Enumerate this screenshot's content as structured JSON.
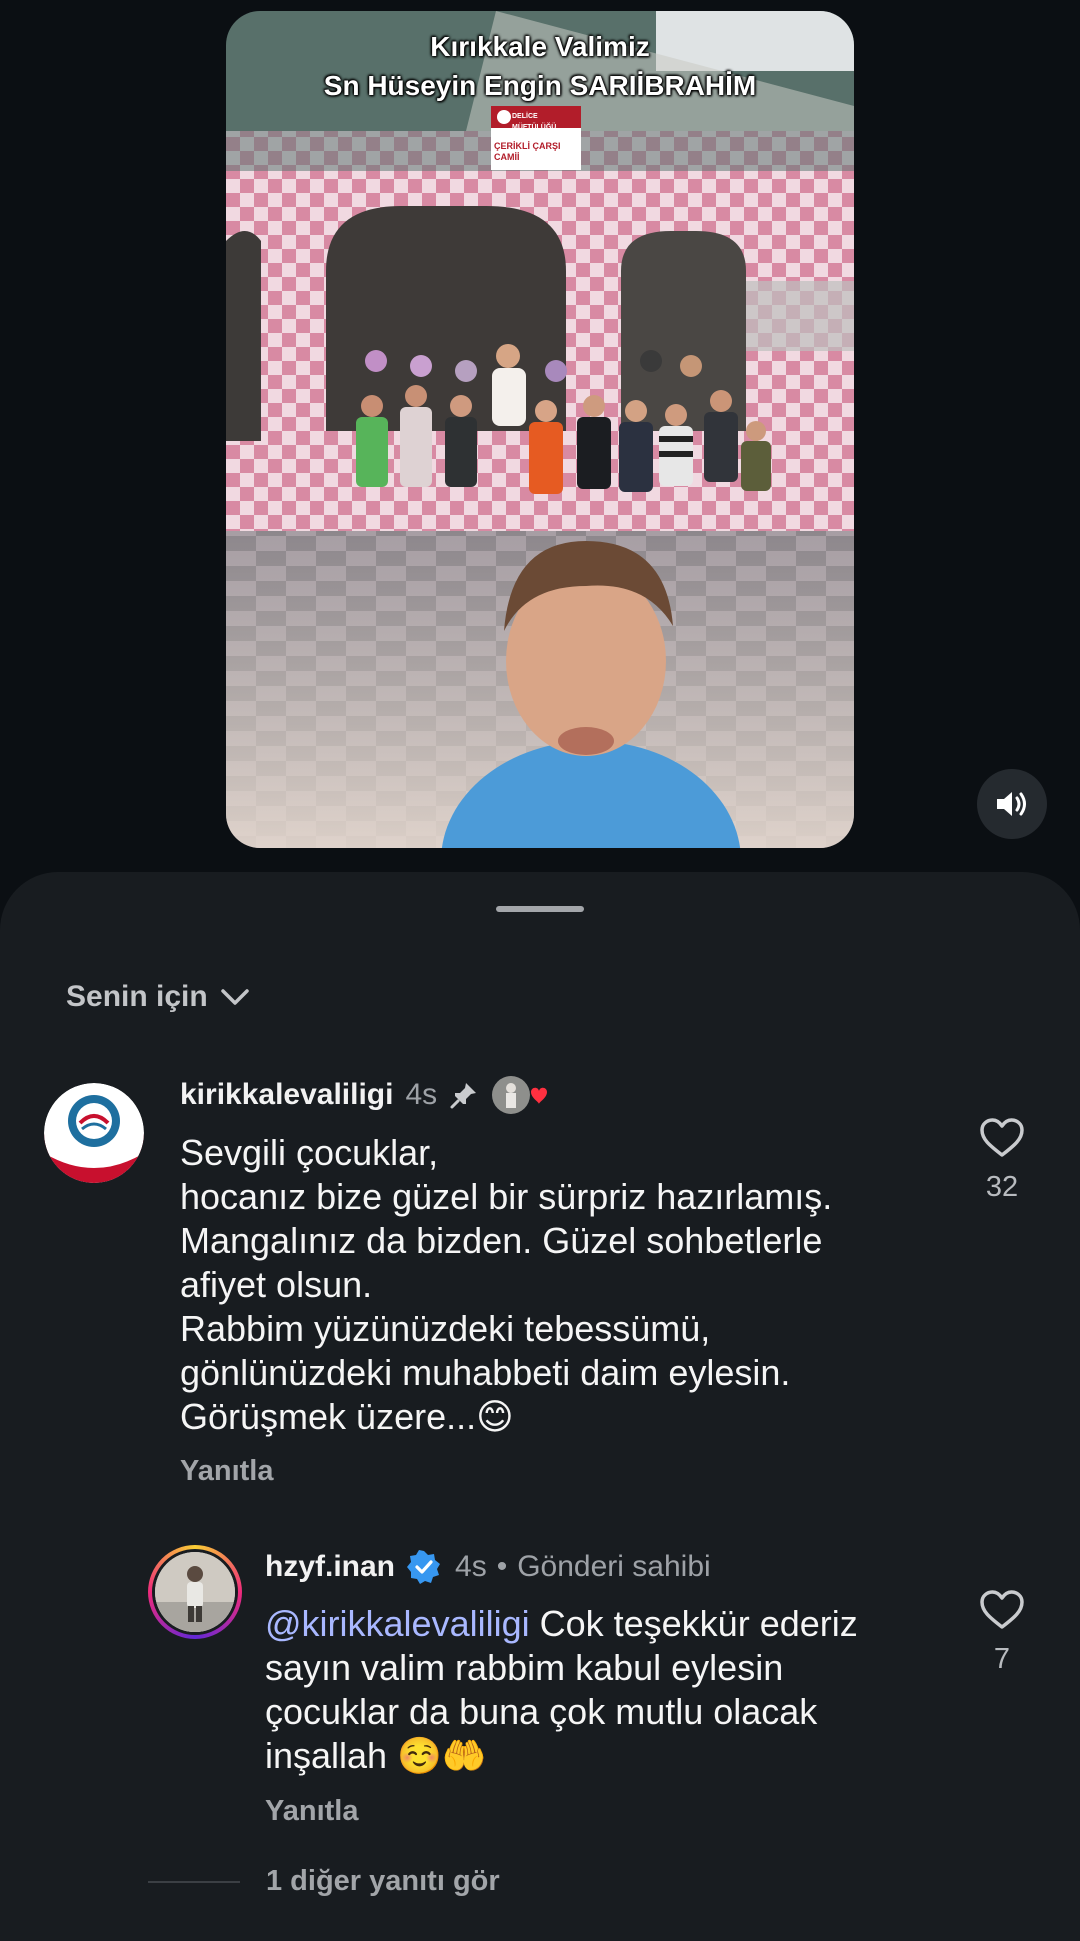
{
  "video": {
    "overlay_title_line1": "Kırıkkale Valimiz",
    "overlay_title_line2": "Sn Hüseyin Engin SARIİBRAHİM",
    "sign_header": "DELİCE MÜFTÜLÜĞÜ",
    "sign_line1": "ÇERİKLİ ÇARŞI",
    "sign_line2": "CAMİİ",
    "sound_icon": "speaker-icon"
  },
  "sheet": {
    "sort_label": "Senin için",
    "sort_icon": "chevron-down-icon"
  },
  "comments": [
    {
      "username": "kirikkalevaliligi",
      "time": "4s",
      "pinned_icon": "pin-icon",
      "liked_by_creator_icon": "creator-heart-icon",
      "lines": [
        "Sevgili çocuklar,",
        "hocanız bize güzel bir sürpriz hazırlamış.",
        "Mangalınız da bizden. Güzel sohbetlerle",
        "afiyet olsun.",
        "Rabbim yüzünüzdeki tebessümü,",
        "gönlünüzdeki muhabbeti daim eylesin.",
        "Görüşmek üzere...😊"
      ],
      "reply_label": "Yanıtla",
      "like_count": "32"
    }
  ],
  "reply": {
    "username": "hzyf.inan",
    "verified_icon": "verified-badge-icon",
    "time": "4s",
    "separator": "•",
    "author_label": "Gönderi sahibi",
    "mention": "@kirikkalevaliligi",
    "line1_rest": " Cok teşekkür ederiz",
    "line2": "sayın valim rabbim kabul eylesin",
    "line3": "çocuklar da buna çok mutlu olacak",
    "line4": "inşallah ☺️🤲",
    "reply_label": "Yanıtla",
    "like_count": "7"
  },
  "more_replies_label": "1 diğer yanıtı gör",
  "colors": {
    "background": "#0b0f13",
    "sheet": "#181c20",
    "mention": "#a9b8ff",
    "verified": "#3797f0",
    "creator_heart": "#ff3040"
  }
}
